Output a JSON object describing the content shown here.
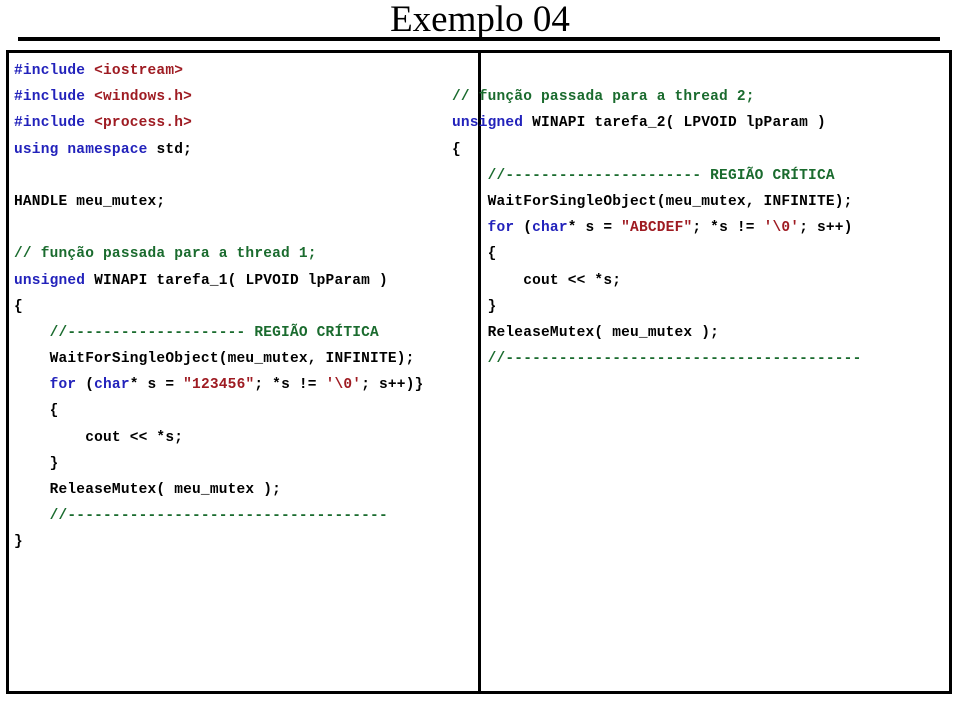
{
  "slide": {
    "title": "Exemplo 04"
  },
  "colors": {
    "keyword": "#2222bb",
    "string": "#9e1b22",
    "comment": "#1a6b2e",
    "plain": "#000000",
    "rule": "#000000",
    "background": "#ffffff"
  },
  "code": {
    "left": {
      "language": "C++",
      "lines": [
        [
          {
            "t": "#include ",
            "c": "pp"
          },
          {
            "t": "<iostream>",
            "c": "str"
          }
        ],
        [
          {
            "t": "#include ",
            "c": "pp"
          },
          {
            "t": "<windows.h>",
            "c": "str"
          }
        ],
        [
          {
            "t": "#include ",
            "c": "pp"
          },
          {
            "t": "<process.h>",
            "c": "str"
          }
        ],
        [
          {
            "t": "using namespace ",
            "c": "kw"
          },
          {
            "t": "std;",
            "c": "plain"
          }
        ],
        [],
        [
          {
            "t": "HANDLE meu_mutex;",
            "c": "plain"
          }
        ],
        [],
        [
          {
            "t": "// função passada para a thread 1;",
            "c": "cmt"
          }
        ],
        [
          {
            "t": "unsigned ",
            "c": "kw"
          },
          {
            "t": "WINAPI tarefa_1( LPVOID lpParam )",
            "c": "plain"
          }
        ],
        [
          {
            "t": "{",
            "c": "plain"
          }
        ],
        [
          {
            "t": "    //-------------------- REGIÃO CRÍTICA",
            "c": "cmt"
          }
        ],
        [
          {
            "t": "    WaitForSingleObject(meu_mutex, INFINITE);",
            "c": "plain"
          }
        ],
        [
          {
            "t": "    ",
            "c": "plain"
          },
          {
            "t": "for ",
            "c": "kw"
          },
          {
            "t": "(",
            "c": "plain"
          },
          {
            "t": "char",
            "c": "kw"
          },
          {
            "t": "* s = ",
            "c": "plain"
          },
          {
            "t": "\"123456\"",
            "c": "str"
          },
          {
            "t": "; *s != ",
            "c": "plain"
          },
          {
            "t": "'\\0'",
            "c": "str"
          },
          {
            "t": "; s++)}",
            "c": "plain"
          }
        ],
        [
          {
            "t": "    {",
            "c": "plain"
          }
        ],
        [
          {
            "t": "        cout << *s;",
            "c": "plain"
          }
        ],
        [
          {
            "t": "    }",
            "c": "plain"
          }
        ],
        [
          {
            "t": "    ReleaseMutex( meu_mutex );",
            "c": "plain"
          }
        ],
        [
          {
            "t": "    //------------------------------------",
            "c": "cmt"
          }
        ],
        [
          {
            "t": "}",
            "c": "plain"
          }
        ]
      ]
    },
    "right": {
      "language": "C++",
      "lines": [
        [],
        [
          {
            "t": "// função passada para a thread 2;",
            "c": "cmt"
          }
        ],
        [
          {
            "t": "unsigned ",
            "c": "kw"
          },
          {
            "t": "WINAPI tarefa_2( LPVOID lpParam )",
            "c": "plain"
          }
        ],
        [
          {
            "t": "{",
            "c": "plain"
          }
        ],
        [
          {
            "t": "    //---------------------- REGIÃO CRÍTICA",
            "c": "cmt"
          }
        ],
        [
          {
            "t": "    WaitForSingleObject(meu_mutex, INFINITE);",
            "c": "plain"
          }
        ],
        [
          {
            "t": "    ",
            "c": "plain"
          },
          {
            "t": "for ",
            "c": "kw"
          },
          {
            "t": "(",
            "c": "plain"
          },
          {
            "t": "char",
            "c": "kw"
          },
          {
            "t": "* s = ",
            "c": "plain"
          },
          {
            "t": "\"ABCDEF\"",
            "c": "str"
          },
          {
            "t": "; *s != ",
            "c": "plain"
          },
          {
            "t": "'\\0'",
            "c": "str"
          },
          {
            "t": "; s++)",
            "c": "plain"
          }
        ],
        [
          {
            "t": "    {",
            "c": "plain"
          }
        ],
        [
          {
            "t": "        cout << *s;",
            "c": "plain"
          }
        ],
        [
          {
            "t": "    }",
            "c": "plain"
          }
        ],
        [
          {
            "t": "    ReleaseMutex( meu_mutex );",
            "c": "plain"
          }
        ],
        [
          {
            "t": "    //----------------------------------------",
            "c": "cmt"
          }
        ]
      ]
    }
  }
}
